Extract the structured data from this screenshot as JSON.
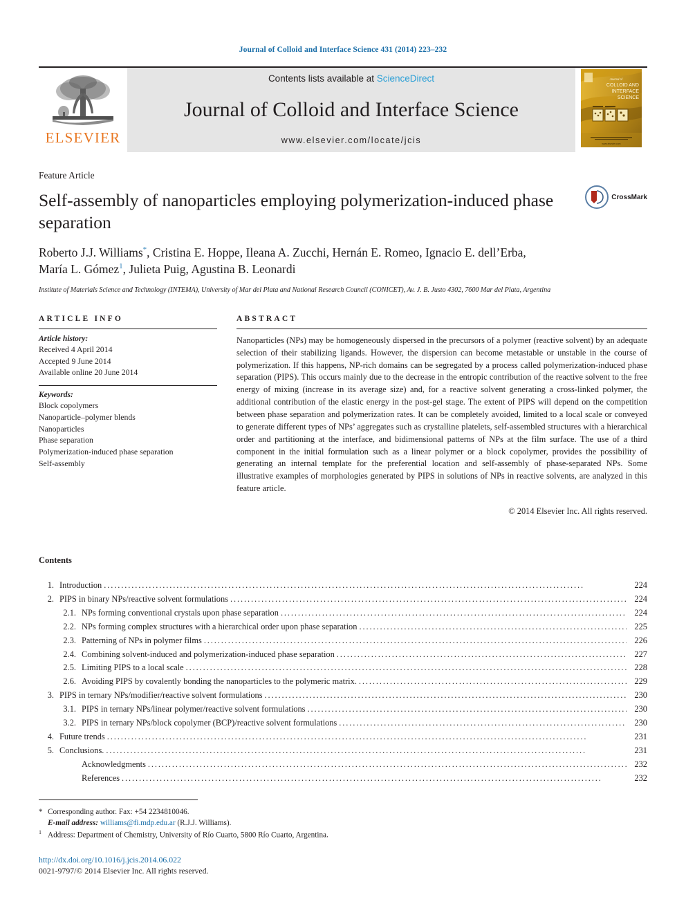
{
  "running_head": "Journal of Colloid and Interface Science 431 (2014) 223–232",
  "masthead": {
    "contents_prefix": "Contents lists available at ",
    "sciencedirect": "ScienceDirect",
    "journal_name": "Journal of Colloid and Interface Science",
    "journal_url": "www.elsevier.com/locate/jcis",
    "publisher_name": "ELSEVIER",
    "cover_title_lines": [
      "Journal of",
      "COLLOID AND",
      "INTERFACE",
      "SCIENCE"
    ]
  },
  "title_block": {
    "article_type": "Feature Article",
    "title": "Self-assembly of nanoparticles employing polymerization-induced phase separation",
    "authors_line_1": "Roberto J.J. Williams *, Cristina E. Hoppe, Ileana A. Zucchi, Hernán E. Romeo, Ignacio E. dell’Erba,",
    "authors_line_2": "María L. Gómez 1, Julieta Puig, Agustina B. Leonardi",
    "affiliation": "Institute of Materials Science and Technology (INTEMA), University of Mar del Plata and National Research Council (CONICET), Av. J. B. Justo 4302, 7600 Mar del Plata, Argentina",
    "crossmark_label": "CrossMark"
  },
  "article_info": {
    "heading": "ARTICLE INFO",
    "history_label": "Article history:",
    "history": [
      "Received 4 April 2014",
      "Accepted 9 June 2014",
      "Available online 20 June 2014"
    ],
    "keywords_label": "Keywords:",
    "keywords": [
      "Block copolymers",
      "Nanoparticle–polymer blends",
      "Nanoparticles",
      "Phase separation",
      "Polymerization-induced phase separation",
      "Self-assembly"
    ]
  },
  "abstract": {
    "heading": "ABSTRACT",
    "text": "Nanoparticles (NPs) may be homogeneously dispersed in the precursors of a polymer (reactive solvent) by an adequate selection of their stabilizing ligands. However, the dispersion can become metastable or unstable in the course of polymerization. If this happens, NP-rich domains can be segregated by a process called polymerization-induced phase separation (PIPS). This occurs mainly due to the decrease in the entropic contribution of the reactive solvent to the free energy of mixing (increase in its average size) and, for a reactive solvent generating a cross-linked polymer, the additional contribution of the elastic energy in the post-gel stage. The extent of PIPS will depend on the competition between phase separation and polymerization rates. It can be completely avoided, limited to a local scale or conveyed to generate different types of NPs’ aggregates such as crystalline platelets, self-assembled structures with a hierarchical order and partitioning at the interface, and bidimensional patterns of NPs at the film surface. The use of a third component in the initial formulation such as a linear polymer or a block copolymer, provides the possibility of generating an internal template for the preferential location and self-assembly of phase-separated NPs. Some illustrative examples of morphologies generated by PIPS in solutions of NPs in reactive solvents, are analyzed in this feature article.",
    "copyright": "© 2014 Elsevier Inc. All rights reserved."
  },
  "contents": {
    "title": "Contents",
    "entries": [
      {
        "num": "1.",
        "level": 1,
        "label": "Introduction",
        "page": "224"
      },
      {
        "num": "2.",
        "level": 1,
        "label": "PIPS in binary NPs/reactive solvent formulations",
        "page": "224"
      },
      {
        "num": "2.1.",
        "level": 2,
        "label": "NPs forming conventional crystals upon phase separation",
        "page": "224"
      },
      {
        "num": "2.2.",
        "level": 2,
        "label": "NPs forming complex structures with a hierarchical order upon phase separation",
        "page": "225"
      },
      {
        "num": "2.3.",
        "level": 2,
        "label": "Patterning of NPs in polymer films",
        "page": "226"
      },
      {
        "num": "2.4.",
        "level": 2,
        "label": "Combining solvent-induced and polymerization-induced phase separation",
        "page": "227"
      },
      {
        "num": "2.5.",
        "level": 2,
        "label": "Limiting PIPS to a local scale",
        "page": "228"
      },
      {
        "num": "2.6.",
        "level": 2,
        "label": "Avoiding PIPS by covalently bonding the nanoparticles to the polymeric matrix.",
        "page": "229"
      },
      {
        "num": "3.",
        "level": 1,
        "label": "PIPS in ternary NPs/modifier/reactive solvent formulations",
        "page": "230"
      },
      {
        "num": "3.1.",
        "level": 2,
        "label": "PIPS in ternary NPs/linear polymer/reactive solvent formulations",
        "page": "230"
      },
      {
        "num": "3.2.",
        "level": 2,
        "label": "PIPS in ternary NPs/block copolymer (BCP)/reactive solvent formulations",
        "page": "230"
      },
      {
        "num": "4.",
        "level": 1,
        "label": "Future trends",
        "page": "231"
      },
      {
        "num": "5.",
        "level": 1,
        "label": "Conclusions.",
        "page": "231"
      },
      {
        "num": "",
        "level": 0,
        "label": "Acknowledgments",
        "page": "232"
      },
      {
        "num": "",
        "level": 0,
        "label": "References",
        "page": "232"
      }
    ]
  },
  "footnotes": {
    "corresponding": "Corresponding author. Fax: +54 2234810046.",
    "email_label": "E-mail address:",
    "email": "williams@fi.mdp.edu.ar",
    "email_owner": "(R.J.J. Williams).",
    "address_mark": "1",
    "address": "Address: Department of Chemistry, University of Río Cuarto, 5800 Río Cuarto, Argentina.",
    "doi": "http://dx.doi.org/10.1016/j.jcis.2014.06.022",
    "issn": "0021-9797/© 2014 Elsevier Inc. All rights reserved."
  },
  "colors": {
    "link": "#1a6ea8",
    "sciencedirect": "#2a9fd6",
    "elsevier_orange": "#e87722",
    "text": "#231f20",
    "masthead_bg": "#e5e5e5"
  }
}
